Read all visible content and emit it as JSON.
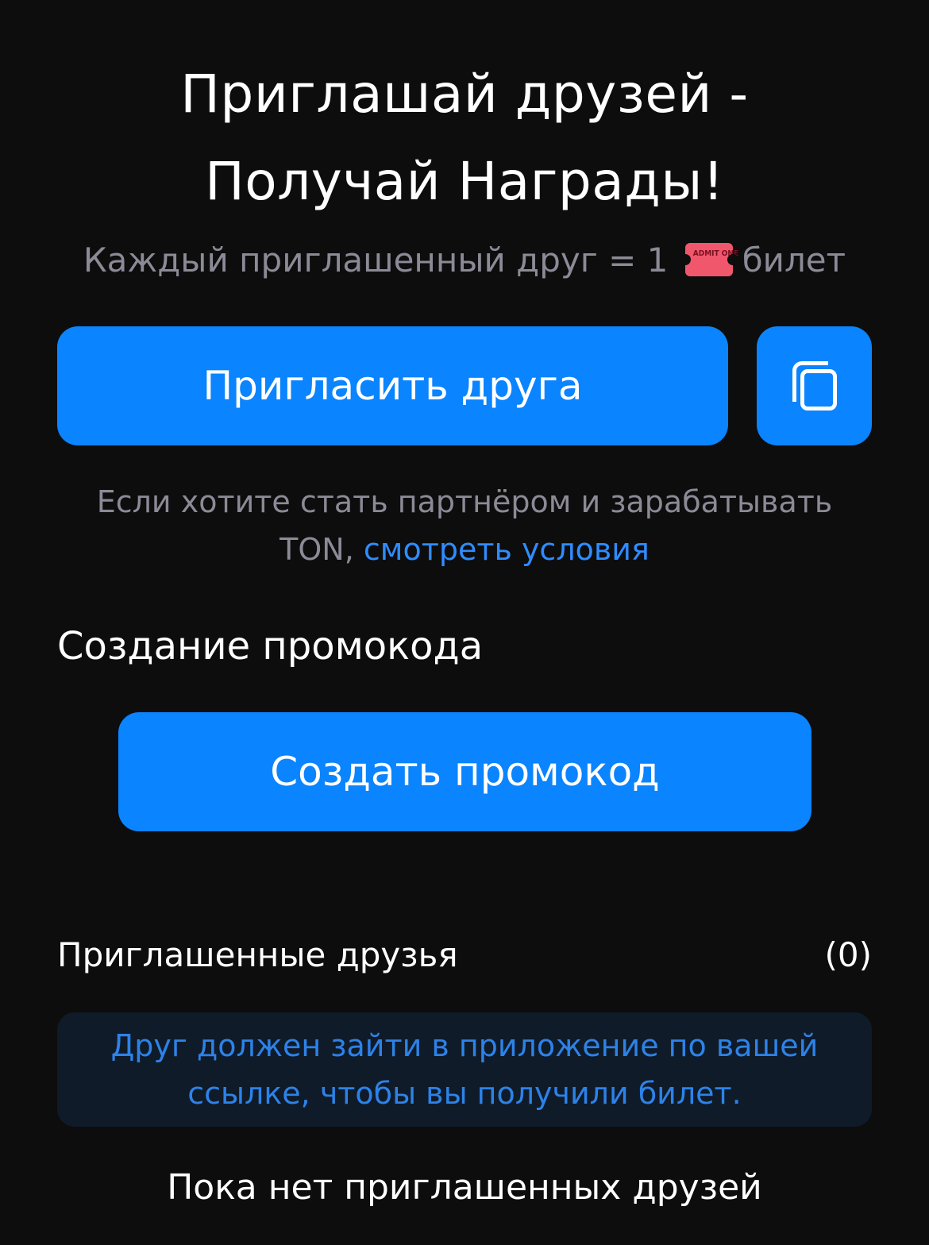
{
  "header": {
    "title_line1": "Приглашай друзей -",
    "title_line2": "Получай Награды!",
    "subtitle_prefix": "Каждый приглашенный друг = 1",
    "ticket_text": "ADMIT ONE",
    "subtitle_suffix": "билет"
  },
  "actions": {
    "invite_label": "Пригласить друга",
    "copy_icon": "copy-icon"
  },
  "partner": {
    "text_line1": "Если хотите стать партнёром и зарабатывать",
    "text_prefix": "TON,",
    "link_label": "смотреть условия"
  },
  "promo": {
    "section_title": "Создание промокода",
    "create_label": "Создать промокод"
  },
  "friends": {
    "title": "Приглашенные друзья",
    "count": "(0)",
    "info_line1": "Друг должен зайти в приложение по вашей",
    "info_line2": "ссылке, чтобы вы получили билет.",
    "empty_text": "Пока нет приглашенных друзей"
  },
  "colors": {
    "background": "#0d0d0d",
    "accent": "#0a84ff",
    "muted_text": "#8b8a96",
    "link": "#2f8cff",
    "info_bg": "#0f1b29"
  }
}
